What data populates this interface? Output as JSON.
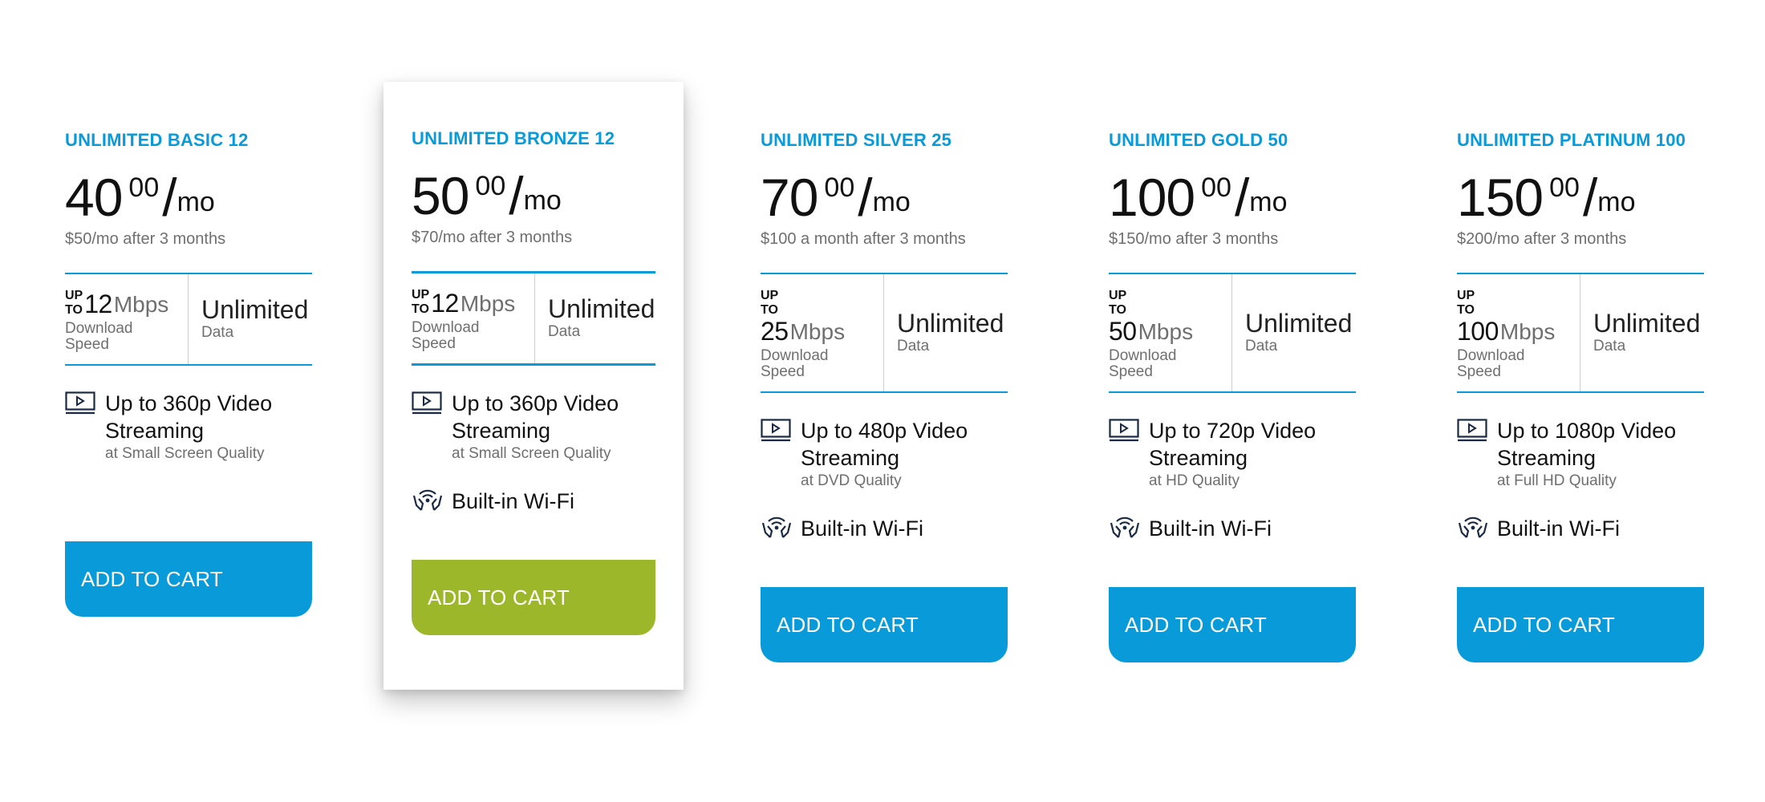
{
  "plans": [
    {
      "name": "UNLIMITED BASIC 12",
      "price_whole": "40",
      "price_cents": "00",
      "price_slash": "/",
      "price_unit": "mo",
      "price_note": "$50/mo after 3 months",
      "speed_prefix_up": "UP",
      "speed_prefix_to": "TO",
      "speed_value": "12",
      "speed_unit": "Mbps",
      "speed_label": "Download Speed",
      "data_value": "Unlimited",
      "data_label": "Data",
      "video_title": "Up to 360p Video Streaming",
      "video_subtitle": "at Small Screen Quality",
      "button_label": "ADD TO CART"
    },
    {
      "name": "UNLIMITED BRONZE 12",
      "price_whole": "50",
      "price_cents": "00",
      "price_slash": "/",
      "price_unit": "mo",
      "price_note": "$70/mo after 3 months",
      "speed_prefix_up": "UP",
      "speed_prefix_to": "TO",
      "speed_value": "12",
      "speed_unit": "Mbps",
      "speed_label": "Download Speed",
      "data_value": "Unlimited",
      "data_label": "Data",
      "video_title": "Up to 360p Video Streaming",
      "video_subtitle": "at Small Screen Quality",
      "wifi_label": "Built-in Wi-Fi",
      "button_label": "ADD TO CART"
    },
    {
      "name": "UNLIMITED SILVER 25",
      "price_whole": "70",
      "price_cents": "00",
      "price_slash": "/",
      "price_unit": "mo",
      "price_note": "$100 a month after 3 months",
      "speed_prefix_up": "UP",
      "speed_prefix_to": "TO",
      "speed_value": "25",
      "speed_unit": "Mbps",
      "speed_label": "Download Speed",
      "data_value": "Unlimited",
      "data_label": "Data",
      "video_title": "Up to 480p Video Streaming",
      "video_subtitle": "at DVD Quality",
      "wifi_label": "Built-in Wi-Fi",
      "button_label": "ADD TO CART"
    },
    {
      "name": "UNLIMITED GOLD 50",
      "price_whole": "100",
      "price_cents": "00",
      "price_slash": "/",
      "price_unit": "mo",
      "price_note": "$150/mo after 3 months",
      "speed_prefix_up": "UP",
      "speed_prefix_to": "TO",
      "speed_value": "50",
      "speed_unit": "Mbps",
      "speed_label": "Download Speed",
      "data_value": "Unlimited",
      "data_label": "Data",
      "video_title": "Up to 720p Video Streaming",
      "video_subtitle": "at HD Quality",
      "wifi_label": "Built-in Wi-Fi",
      "button_label": "ADD TO CART"
    },
    {
      "name": "UNLIMITED PLATINUM 100",
      "price_whole": "150",
      "price_cents": "00",
      "price_slash": "/",
      "price_unit": "mo",
      "price_note": "$200/mo after 3 months",
      "speed_prefix_up": "UP",
      "speed_prefix_to": "TO",
      "speed_value": "100",
      "speed_unit": "Mbps",
      "speed_label": "Download Speed",
      "data_value": "Unlimited",
      "data_label": "Data",
      "video_title": "Up to 1080p Video Streaming",
      "video_subtitle": "at Full HD Quality",
      "wifi_label": "Built-in Wi-Fi",
      "button_label": "ADD TO CART"
    }
  ],
  "colors": {
    "accent": "#089ad9",
    "featured_button": "#9db72a",
    "muted_text": "#6f6f6f"
  },
  "icons": {
    "video": "video-screen-icon",
    "wifi": "wifi-hands-icon"
  }
}
